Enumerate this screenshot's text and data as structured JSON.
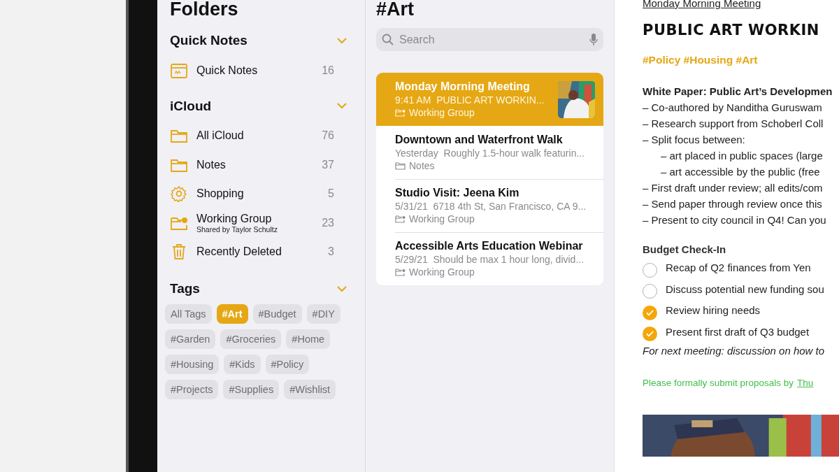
{
  "sidebar": {
    "title": "Folders",
    "sections": [
      {
        "title": "Quick Notes",
        "expanded": true,
        "items": [
          {
            "kind": "quicknote",
            "label": "Quick Notes",
            "count": "16"
          }
        ]
      },
      {
        "title": "iCloud",
        "expanded": true,
        "items": [
          {
            "kind": "folder",
            "label": "All iCloud",
            "count": "76"
          },
          {
            "kind": "folder",
            "label": "Notes",
            "count": "37"
          },
          {
            "kind": "smart",
            "label": "Shopping",
            "count": "5"
          },
          {
            "kind": "shared",
            "label": "Working Group",
            "subtitle": "Shared by Taylor Schultz",
            "count": "23"
          },
          {
            "kind": "trash",
            "label": "Recently Deleted",
            "count": "3"
          }
        ]
      }
    ],
    "tags": {
      "title": "Tags",
      "expanded": true,
      "items": [
        {
          "label": "All Tags",
          "selected": false
        },
        {
          "label": "#Art",
          "selected": true
        },
        {
          "label": "#Budget",
          "selected": false
        },
        {
          "label": "#DIY",
          "selected": false
        },
        {
          "label": "#Garden",
          "selected": false
        },
        {
          "label": "#Groceries",
          "selected": false
        },
        {
          "label": "#Home",
          "selected": false
        },
        {
          "label": "#Housing",
          "selected": false
        },
        {
          "label": "#Kids",
          "selected": false
        },
        {
          "label": "#Policy",
          "selected": false
        },
        {
          "label": "#Projects",
          "selected": false
        },
        {
          "label": "#Supplies",
          "selected": false
        },
        {
          "label": "#Wishlist",
          "selected": false
        }
      ]
    }
  },
  "note_list": {
    "title": "#Art",
    "search": {
      "placeholder": "Search"
    },
    "notes": [
      {
        "title": "Monday Morning Meeting",
        "date": "9:41 AM",
        "preview": "PUBLIC ART WORKIN...",
        "folder": {
          "label": "Working Group",
          "kind": "shared"
        },
        "selected": true
      },
      {
        "title": "Downtown and Waterfront Walk",
        "date": "Yesterday",
        "preview": "Roughly 1.5-hour walk featurin...",
        "folder": {
          "label": "Notes",
          "kind": "folder"
        },
        "selected": false
      },
      {
        "title": "Studio Visit: Jeena Kim",
        "date": "5/31/21",
        "preview": "6718 4th St, San Francisco, CA 9...",
        "folder": {
          "label": "Working Group",
          "kind": "shared"
        },
        "selected": false
      },
      {
        "title": "Accessible Arts Education Webinar",
        "date": "5/29/21",
        "preview": "Should be max 1 hour long, divid...",
        "folder": {
          "label": "Working Group",
          "kind": "shared"
        },
        "selected": false
      }
    ]
  },
  "editor": {
    "link": "Monday Morning Meeting",
    "headline": "PUBLIC ART WORKIN",
    "tags": "#Policy #Housing #Art",
    "blocks": [
      {
        "kind": "heading",
        "text": "White Paper: Public Art’s Developmen"
      },
      {
        "kind": "line",
        "text": "– Co-authored by Nanditha Guruswam"
      },
      {
        "kind": "line",
        "text": "– Research support from Schoberl Coll"
      },
      {
        "kind": "line",
        "text": "– Split focus between:",
        "children": [
          {
            "kind": "line",
            "text": "– art placed in public spaces (large"
          },
          {
            "kind": "line",
            "text": "– art accessible by the public (free"
          }
        ]
      },
      {
        "kind": "line",
        "text": "– First draft under review; all edits/com"
      },
      {
        "kind": "line",
        "text": "– Send paper through review once this"
      },
      {
        "kind": "line",
        "text": "– Present to city council in Q4! Can you"
      }
    ],
    "checklist_title": "Budget Check-In",
    "checklist": [
      {
        "text": "Recap of Q2 finances from Yen",
        "checked": false
      },
      {
        "text": "Discuss potential new funding sou",
        "checked": false
      },
      {
        "text": "Review hiring needs",
        "checked": true
      },
      {
        "text": "Present first draft of Q3 budget",
        "checked": true
      }
    ],
    "italic_note": "For next meeting: discussion on how to",
    "handwriting": {
      "lead": "Please formally submit proposals by",
      "underlined": "Thu"
    }
  }
}
